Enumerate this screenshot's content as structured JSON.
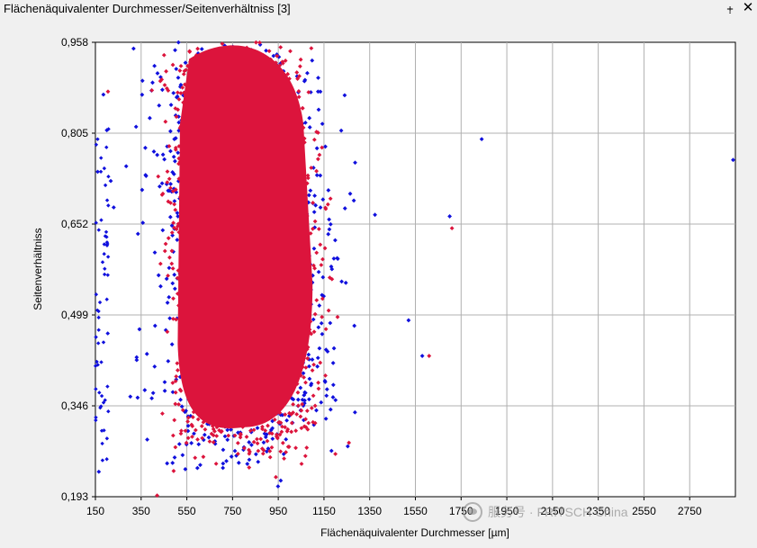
{
  "window": {
    "title": "Flächenäquivalenter Durchmesser/Seitenverhältniss [3]",
    "pin_icon": "pin-icon",
    "close_icon": "close-icon"
  },
  "watermark": {
    "text": "服务号 · FRITSCH China",
    "icon": "wechat-icon"
  },
  "chart_data": {
    "type": "scatter",
    "xlabel": "Flächenäquivalenter Durchmesser [µm]",
    "ylabel": "Seitenverhältniss",
    "xlim": [
      150,
      2950
    ],
    "ylim": [
      0.193,
      0.958
    ],
    "x_ticks": [
      "150",
      "350",
      "550",
      "750",
      "950",
      "1150",
      "1350",
      "1550",
      "1750",
      "1950",
      "2150",
      "2350",
      "2550",
      "2750"
    ],
    "y_ticks": [
      "0,958",
      "0,805",
      "0,652",
      "0,499",
      "0,346",
      "0,193"
    ],
    "grid": true,
    "legend": "none",
    "series": [
      {
        "color": "#1010dd",
        "outliers": [
          [
            1840,
            0.795
          ],
          [
            2940,
            0.76
          ],
          [
            1700,
            0.665
          ],
          [
            165,
            0.235
          ],
          [
            160,
            0.74
          ],
          [
            200,
            0.81
          ],
          [
            185,
            0.87
          ],
          [
            230,
            0.68
          ],
          [
            1520,
            0.49
          ],
          [
            1580,
            0.43
          ]
        ]
      },
      {
        "color": "#dc143c",
        "outliers": [
          [
            205,
            0.875
          ],
          [
            1710,
            0.645
          ],
          [
            1610,
            0.43
          ],
          [
            420,
            0.195
          ],
          [
            1200,
            0.265
          ]
        ]
      }
    ],
    "cloud": {
      "core_x_range": [
        480,
        1080
      ],
      "core_y_range": [
        0.27,
        0.94
      ],
      "center": [
        760,
        0.64
      ]
    }
  }
}
